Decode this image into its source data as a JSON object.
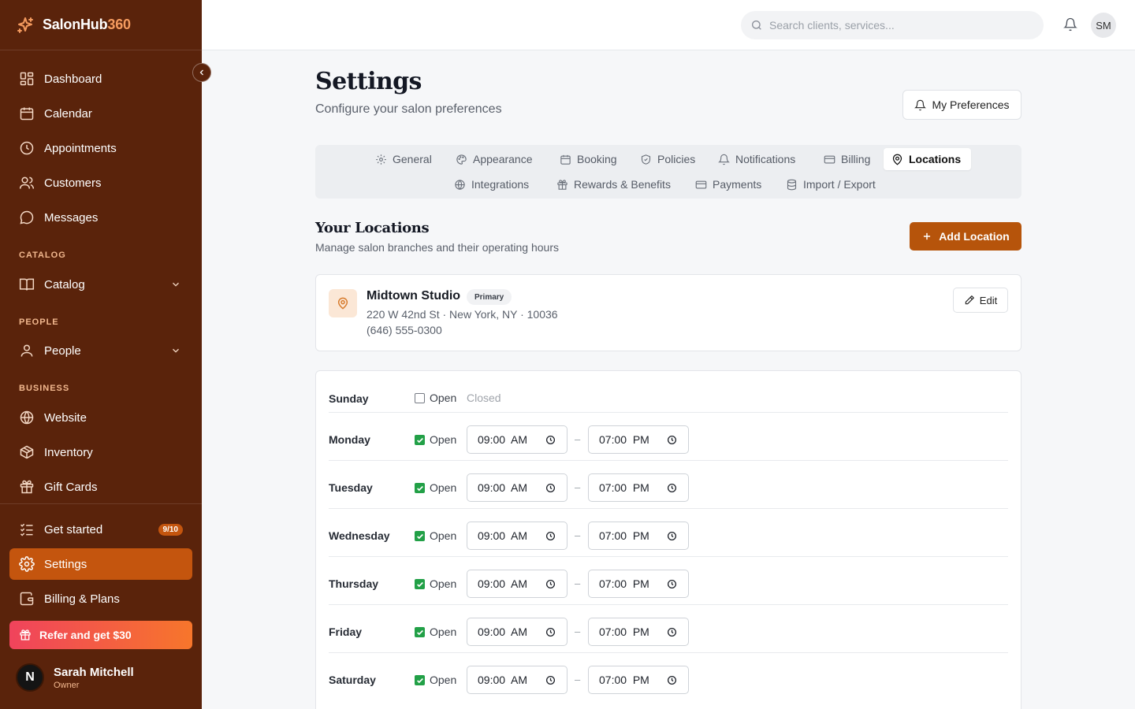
{
  "brand": {
    "name_main": "SalonHub",
    "name_accent": "360"
  },
  "sidebar": {
    "main_items": [
      {
        "label": "Dashboard",
        "icon": "dashboard-icon"
      },
      {
        "label": "Calendar",
        "icon": "calendar-icon"
      },
      {
        "label": "Appointments",
        "icon": "clock-icon"
      },
      {
        "label": "Customers",
        "icon": "users-icon"
      },
      {
        "label": "Messages",
        "icon": "message-icon"
      }
    ],
    "catalog_label": "CATALOG",
    "catalog_item": "Catalog",
    "people_label": "PEOPLE",
    "people_item": "People",
    "business_label": "BUSINESS",
    "business_items": [
      {
        "label": "Website",
        "icon": "globe-icon"
      },
      {
        "label": "Inventory",
        "icon": "box-icon"
      },
      {
        "label": "Gift Cards",
        "icon": "gift-icon"
      }
    ],
    "get_started": {
      "label": "Get started",
      "badge": "9/10"
    },
    "settings": "Settings",
    "billing": "Billing & Plans",
    "refer": "Refer and get $30",
    "user": {
      "initial": "N",
      "name": "Sarah Mitchell",
      "role": "Owner"
    }
  },
  "topbar": {
    "search_placeholder": "Search clients, services...",
    "avatar": "SM"
  },
  "page": {
    "title": "Settings",
    "subtitle": "Configure your salon preferences",
    "preferences_button": "My Preferences"
  },
  "tabs": {
    "row1": [
      "General",
      "Appearance",
      "Booking",
      "Policies",
      "Notifications",
      "Billing",
      "Locations"
    ],
    "row2": [
      "Integrations",
      "Rewards & Benefits",
      "Payments",
      "Import / Export"
    ],
    "active": "Locations"
  },
  "locations": {
    "title": "Your Locations",
    "subtitle": "Manage salon branches and their operating hours",
    "add_button": "Add Location",
    "card": {
      "name": "Midtown Studio",
      "badge": "Primary",
      "address": "220 W 42nd St · New York, NY · 10036",
      "phone": "(646) 555-0300",
      "edit": "Edit"
    }
  },
  "hours": {
    "open_label": "Open",
    "closed_label": "Closed",
    "separator": "–",
    "days": [
      {
        "day": "Sunday",
        "open": false,
        "from": "",
        "to": ""
      },
      {
        "day": "Monday",
        "open": true,
        "from": "09:00  AM",
        "to": "07:00  PM"
      },
      {
        "day": "Tuesday",
        "open": true,
        "from": "09:00  AM",
        "to": "07:00  PM"
      },
      {
        "day": "Wednesday",
        "open": true,
        "from": "09:00  AM",
        "to": "07:00  PM"
      },
      {
        "day": "Thursday",
        "open": true,
        "from": "09:00  AM",
        "to": "07:00  PM"
      },
      {
        "day": "Friday",
        "open": true,
        "from": "09:00  AM",
        "to": "07:00  PM"
      },
      {
        "day": "Saturday",
        "open": true,
        "from": "09:00  AM",
        "to": "07:00  PM"
      }
    ]
  },
  "colors": {
    "sidebar": "#5a230b",
    "accent": "#b6540b",
    "active_nav": "#c4550e",
    "check": "#22a047"
  }
}
